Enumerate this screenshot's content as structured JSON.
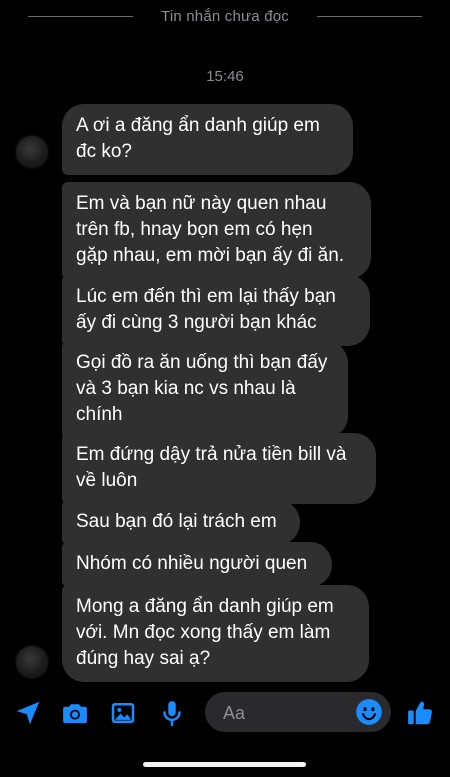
{
  "header": {
    "unread_divider": "Tin nhắn chưa đọc"
  },
  "timestamp": "15:46",
  "messages": [
    {
      "text": "A ơi a đăng ẩn danh giúp em\nđc ko?"
    },
    {
      "text": "Em và bạn nữ này quen nhau\ntrên fb, hnay bọn em có hẹn\ngặp nhau, em mời bạn ấy đi ăn."
    },
    {
      "text": "Lúc em đến thì em lại thấy bạn\nấy đi cùng 3 người bạn khác"
    },
    {
      "text": "Gọi đồ ra ăn uống thì bạn đấy\nvà 3 bạn kia nc vs nhau là\nchính"
    },
    {
      "text": "Em đứng dậy trả nửa tiền bill và\nvề luôn"
    },
    {
      "text": "Sau bạn đó lại trách em"
    },
    {
      "text": "Nhóm có nhiều người quen"
    },
    {
      "text": "Mong a đăng ẩn danh giúp em\nvới. Mn đọc xong thấy em làm\nđúng hay sai ạ?"
    }
  ],
  "composer": {
    "placeholder": "Aa",
    "icons": [
      "location-arrow-icon",
      "camera-icon",
      "gallery-icon",
      "microphone-icon",
      "emoji-icon",
      "like-thumb-icon"
    ]
  },
  "colors": {
    "accent": "#1a8cff",
    "bubble": "#303030",
    "background": "#000000",
    "muted": "#8e8e93"
  }
}
